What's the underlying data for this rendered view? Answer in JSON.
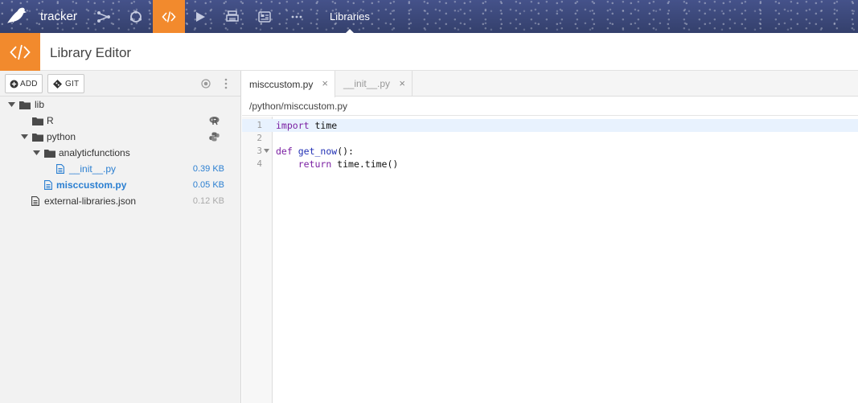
{
  "topnav": {
    "brand": "tracker",
    "active_section": "Libraries",
    "icons": [
      "bird-logo-icon",
      "flow-icon",
      "recipes-icon",
      "code-icon",
      "run-icon",
      "printer-icon",
      "dashboard-icon",
      "more-icon"
    ]
  },
  "header": {
    "title": "Library Editor"
  },
  "sidebar": {
    "add_label": "ADD",
    "git_label": "GIT",
    "tree": {
      "lib": "lib",
      "r": "R",
      "python": "python",
      "analyticfunctions": "analyticfunctions",
      "init_file": "__init__.py",
      "init_size": "0.39 KB",
      "misccustom_file": "misccustom.py",
      "misccustom_size": "0.05 KB",
      "external_file": "external-libraries.json",
      "external_size": "0.12 KB"
    }
  },
  "editor": {
    "tabs": [
      {
        "label": "misccustom.py",
        "active": true
      },
      {
        "label": "__init__.py",
        "active": false
      }
    ],
    "close_glyph": "×",
    "path": "/python/misccustom.py",
    "line_numbers": [
      "1",
      "2",
      "3",
      "4"
    ],
    "code": {
      "l1_kw": "import",
      "l1_rest": " time",
      "l3_kw": "def",
      "l3_fn": "get_now",
      "l3_rest": "():",
      "l4_indent": "    ",
      "l4_kw": "return",
      "l4_rest": " time.time()"
    }
  },
  "colors": {
    "accent": "#f28a2d",
    "nav_bg": "#3d4a78",
    "link": "#2b7fd1",
    "keyword": "#7a1fa2",
    "function": "#2231b5"
  }
}
